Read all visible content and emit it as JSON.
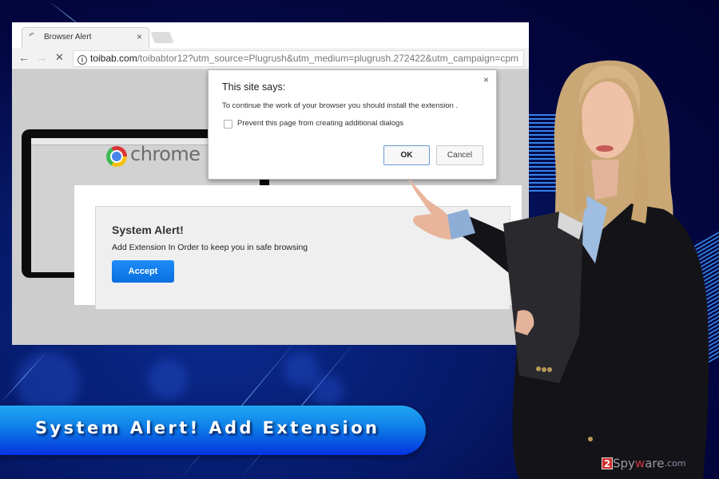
{
  "browser": {
    "tab": {
      "title": "Browser Alert",
      "close_glyph": "×",
      "loading_icon": "spinner-icon"
    },
    "nav": {
      "back_glyph": "←",
      "forward_glyph": "→",
      "stop_glyph": "✕"
    },
    "omnibox": {
      "info_glyph": "i",
      "domain": "toibab.com",
      "path": "/toibabtor12?utm_source=Plugrush&utm_medium=plugrush.272422&utm_campaign=cpm"
    },
    "background_page": {
      "brand_word": "chrome"
    }
  },
  "js_dialog": {
    "title": "This site says:",
    "message": "To continue the work of your browser you should install the extension .",
    "checkbox_label": "Prevent this page from creating additional dialogs",
    "checkbox_checked": false,
    "ok_label": "OK",
    "cancel_label": "Cancel",
    "close_glyph": "×"
  },
  "system_alert": {
    "title": "System Alert!",
    "message": "Add Extension In Order to keep you in safe browsing",
    "button_label": "Accept",
    "button_color": "#1580f0"
  },
  "banner": {
    "text": "System Alert! Add Extension"
  },
  "watermark": {
    "badge": "2",
    "part_a": "Spy",
    "part_b": "w",
    "part_c": "are",
    "part_d": ".com"
  },
  "colors": {
    "background": "#03063f",
    "banner_top": "#21a8f4",
    "banner_bottom": "#0632e0"
  }
}
